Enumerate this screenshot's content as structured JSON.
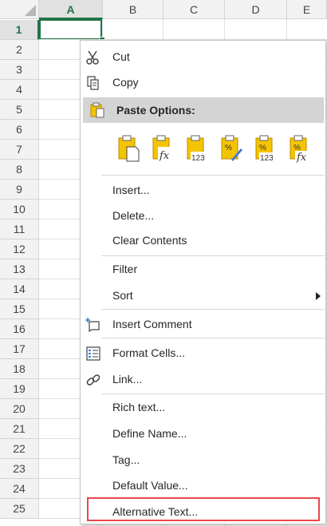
{
  "sheet": {
    "columns": [
      "A",
      "B",
      "C",
      "D",
      "E"
    ],
    "rows": [
      "1",
      "2",
      "3",
      "4",
      "5",
      "6",
      "7",
      "8",
      "9",
      "10",
      "11",
      "12",
      "13",
      "14",
      "15",
      "16",
      "17",
      "18",
      "19",
      "20",
      "21",
      "22",
      "23",
      "24",
      "25"
    ],
    "selected_cell": "A1"
  },
  "menu": {
    "cut": "Cut",
    "copy": "Copy",
    "paste_options": "Paste Options:",
    "paste_icons": [
      "paste-icon",
      "paste-formulas-icon",
      "paste-values-icon",
      "paste-formatting-icon",
      "paste-values-number-format-icon",
      "paste-formulas-number-format-icon"
    ],
    "insert": "Insert...",
    "delete": "Delete...",
    "clear_contents": "Clear Contents",
    "filter": "Filter",
    "sort": "Sort",
    "insert_comment": "Insert Comment",
    "format_cells": "Format Cells...",
    "link": "Link...",
    "rich_text": "Rich text...",
    "define_name": "Define Name...",
    "tag": "Tag...",
    "default_value": "Default Value...",
    "alternative_text": "Alternative Text..."
  },
  "colors": {
    "accent": "#217346",
    "highlight_box": "#e8484b",
    "clipboard": "#f5c400"
  }
}
